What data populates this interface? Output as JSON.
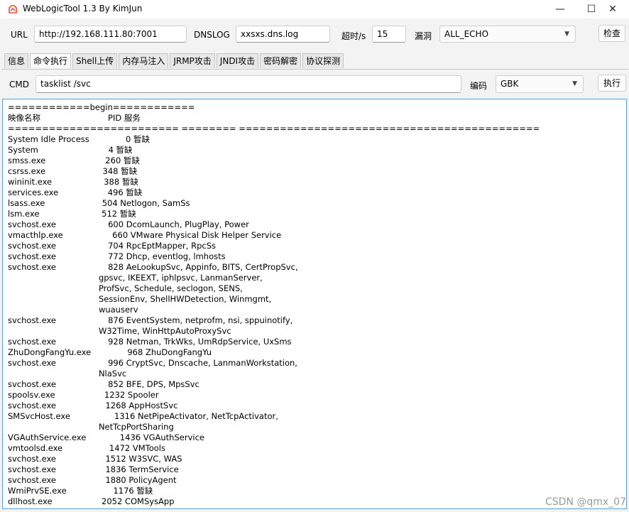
{
  "window": {
    "title": "WebLogicTool 1.3 By KimJun",
    "minimize": "—",
    "maximize": "☐",
    "close": "✕"
  },
  "toolbar": {
    "url_label": "URL",
    "url_value": "http://192.168.111.80:7001",
    "dnslog_label": "DNSLOG",
    "dnslog_value": "xxsxs.dns.log",
    "timeout_label": "超时/s",
    "timeout_value": "15",
    "vuln_label": "漏洞",
    "vuln_value": "ALL_ECHO",
    "check_button": "检查"
  },
  "tabs": [
    {
      "label": "信息"
    },
    {
      "label": "命令执行"
    },
    {
      "label": "Shell上传"
    },
    {
      "label": "内存马注入"
    },
    {
      "label": "JRMP攻击"
    },
    {
      "label": "JNDI攻击"
    },
    {
      "label": "密码解密"
    },
    {
      "label": "协议探测"
    }
  ],
  "active_tab": "命令执行",
  "cmd": {
    "label": "CMD",
    "value": "tasklist /svc",
    "encoding_label": "编码",
    "encoding_value": "GBK",
    "execute_button": "执行"
  },
  "output": "============begin============\n映像名称                          PID 服务\n========================= ======== ============================================\nSystem Idle Process              0 暂缺\nSystem                           4 暂缺\nsmss.exe                       260 暂缺\ncsrss.exe                      348 暂缺\nwininit.exe                    388 暂缺\nservices.exe                   496 暂缺\nlsass.exe                      504 Netlogon, SamSs\nlsm.exe                        512 暂缺\nsvchost.exe                    600 DcomLaunch, PlugPlay, Power\nvmacthlp.exe                   660 VMware Physical Disk Helper Service\nsvchost.exe                    704 RpcEptMapper, RpcSs\nsvchost.exe                    772 Dhcp, eventlog, lmhosts\nsvchost.exe                    828 AeLookupSvc, Appinfo, BITS, CertPropSvc,\n                                   gpsvc, IKEEXT, iphlpsvc, LanmanServer,\n                                   ProfSvc, Schedule, seclogon, SENS,\n                                   SessionEnv, ShellHWDetection, Winmgmt,\n                                   wuauserv\nsvchost.exe                    876 EventSystem, netprofm, nsi, sppuinotify,\n                                   W32Time, WinHttpAutoProxySvc\nsvchost.exe                    928 Netman, TrkWks, UmRdpService, UxSms\nZhuDongFangYu.exe              968 ZhuDongFangYu\nsvchost.exe                    996 CryptSvc, Dnscache, LanmanWorkstation,\n                                   NlaSvc\nsvchost.exe                    852 BFE, DPS, MpsSvc\nspoolsv.exe                   1232 Spooler\nsvchost.exe                   1268 AppHostSvc\nSMSvcHost.exe                 1316 NetPipeActivator, NetTcpActivator,\n                                   NetTcpPortSharing\nVGAuthService.exe             1436 VGAuthService\nvmtoolsd.exe                  1472 VMTools\nsvchost.exe                   1512 W3SVC, WAS\nsvchost.exe                   1836 TermService\nsvchost.exe                   1880 PolicyAgent\nWmiPrvSE.exe                  1176 暂缺\ndllhost.exe                   2052 COMSysApp",
  "watermark": "CSDN @qmx_07",
  "colors": {
    "output_border": "#5aa0d8",
    "app_icon": "#e0523a"
  },
  "icons": {
    "app": "app-logo-icon",
    "dropdown": "chevron-down-icon"
  }
}
